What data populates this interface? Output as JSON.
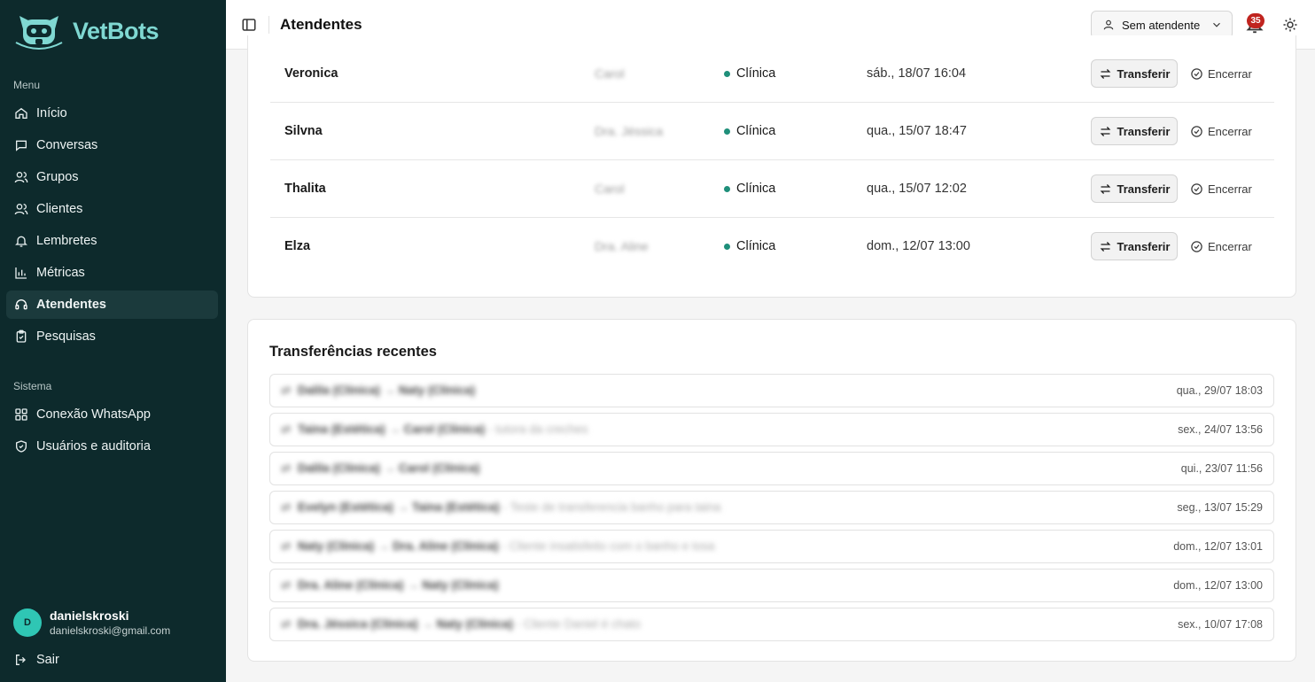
{
  "brand": {
    "name": "VetBots",
    "accent": "#7fd8d2"
  },
  "sidebar": {
    "menu_label": "Menu",
    "menu_items": [
      {
        "label": "Início",
        "icon": "home-icon"
      },
      {
        "label": "Conversas",
        "icon": "message-icon"
      },
      {
        "label": "Grupos",
        "icon": "users-icon"
      },
      {
        "label": "Clientes",
        "icon": "users-icon"
      },
      {
        "label": "Lembretes",
        "icon": "bell-icon"
      },
      {
        "label": "Métricas",
        "icon": "bar-chart-icon"
      },
      {
        "label": "Atendentes",
        "icon": "headset-icon",
        "active": true
      },
      {
        "label": "Pesquisas",
        "icon": "clipboard-icon"
      }
    ],
    "system_label": "Sistema",
    "system_items": [
      {
        "label": "Conexão WhatsApp",
        "icon": "grid-icon"
      },
      {
        "label": "Usuários e auditoria",
        "icon": "shield-icon"
      }
    ],
    "user": {
      "initial": "D",
      "name": "danielskroski",
      "email": "danielskroski@gmail.com"
    },
    "logout_label": "Sair"
  },
  "header": {
    "title": "Atendentes",
    "attendant_select": "Sem atendente",
    "notification_count": "35"
  },
  "active_chats": {
    "transfer_label": "Transferir",
    "end_label": "Encerrar",
    "rows": [
      {
        "name": "Veronica",
        "agent": "Carol",
        "sector": "Clínica",
        "date": "sáb., 18/07 16:04"
      },
      {
        "name": "Silvna",
        "agent": "Dra. Jéssica",
        "sector": "Clínica",
        "date": "qua., 15/07 18:47"
      },
      {
        "name": "Thalita",
        "agent": "Carol",
        "sector": "Clínica",
        "date": "qua., 15/07 12:02"
      },
      {
        "name": "Elza",
        "agent": "Dra. Aline",
        "sector": "Clínica",
        "date": "dom., 12/07 13:00"
      }
    ]
  },
  "recent_transfers": {
    "title": "Transferências recentes",
    "rows": [
      {
        "from": "Dalila (Clínica)",
        "to": "Naty (Clínica)",
        "note": "",
        "date": "qua., 29/07 18:03"
      },
      {
        "from": "Taina (Estética)",
        "to": "Carol (Clínica)",
        "note": "- tutora da creches",
        "date": "sex., 24/07 13:56"
      },
      {
        "from": "Dalila (Clínica)",
        "to": "Carol (Clínica)",
        "note": "",
        "date": "qui., 23/07 11:56"
      },
      {
        "from": "Evelyn (Estética)",
        "to": "Taina (Estética)",
        "note": "- Teste de transferencia banho para taina",
        "date": "seg., 13/07 15:29"
      },
      {
        "from": "Naty (Clínica)",
        "to": "Dra. Aline (Clínica)",
        "note": "- Cliente insatisfeito com o banho e tosa",
        "date": "dom., 12/07 13:01"
      },
      {
        "from": "Dra. Aline (Clínica)",
        "to": "Naty (Clínica)",
        "note": "",
        "date": "dom., 12/07 13:00"
      },
      {
        "from": "Dra. Jéssica (Clínica)",
        "to": "Naty (Clínica)",
        "note": "- Cliente Daniel é chato",
        "date": "sex., 10/07 17:08"
      }
    ]
  }
}
